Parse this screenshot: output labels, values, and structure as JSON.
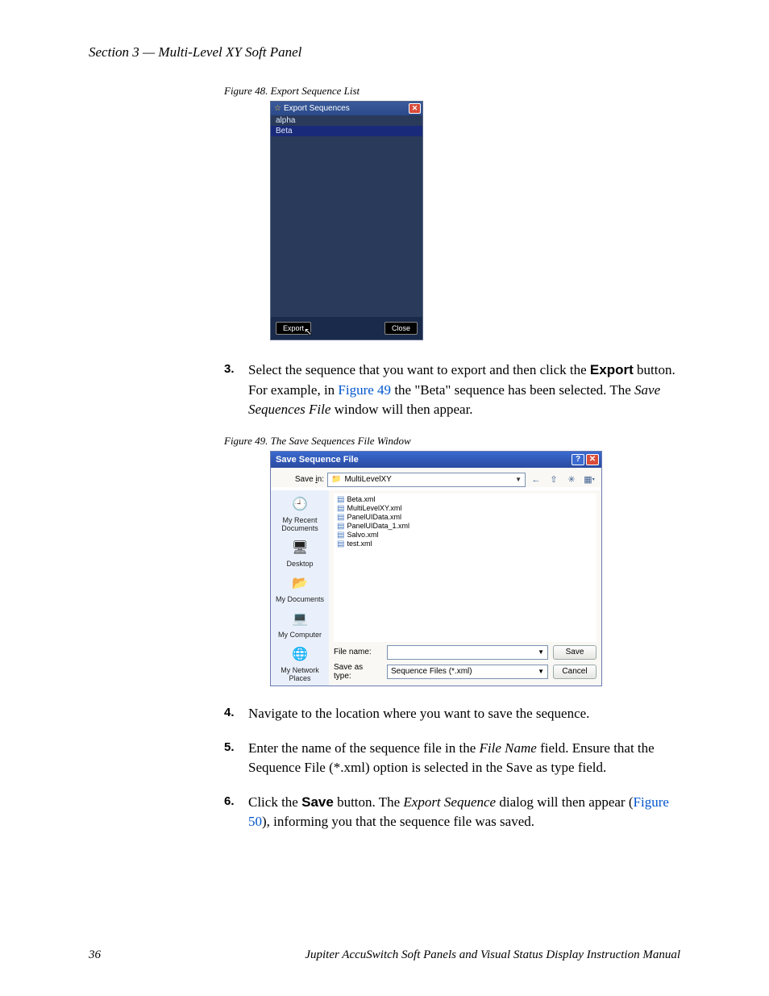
{
  "section_header": "Section 3 — Multi-Level XY Soft Panel",
  "fig48": {
    "caption": "Figure 48.  Export Sequence List",
    "title": "Export Sequences",
    "items": [
      "alpha",
      "Beta"
    ],
    "export_btn": "Export",
    "close_btn": "Close"
  },
  "step3": {
    "num": "3.",
    "t1": "Select the sequence that you want to export and then click the ",
    "export_bold": "Export",
    "t2": " button. For example, in ",
    "link": "Figure 49",
    "t3": " the \"Beta\" sequence has been selected. The ",
    "italic": "Save Sequences File",
    "t4": " window will then appear."
  },
  "fig49": {
    "caption": "Figure 49.  The Save Sequences File Window",
    "title": "Save Sequence File",
    "savein_label": "Save in:",
    "savein_value": "MultiLevelXY",
    "sidebar": [
      "My Recent Documents",
      "Desktop",
      "My Documents",
      "My Computer",
      "My Network Places"
    ],
    "files": [
      "Beta.xml",
      "MultiLevelXY.xml",
      "PanelUIData.xml",
      "PanelUIData_1.xml",
      "Salvo.xml",
      "test.xml"
    ],
    "filename_label": "File name:",
    "saveastype_label": "Save as type:",
    "saveastype_value": "Sequence Files (*.xml)",
    "save_btn": "Save",
    "cancel_btn": "Cancel"
  },
  "step4": {
    "num": "4.",
    "text": "Navigate to the location where you want to save the sequence."
  },
  "step5": {
    "num": "5.",
    "t1": "Enter the name of the sequence file in the ",
    "italic": "File Name",
    "t2": " field. Ensure that the Sequence File (*.xml) option is selected in the Save as type field."
  },
  "step6": {
    "num": "6.",
    "t1": "Click the ",
    "bold": "Save",
    "t2": " button. The ",
    "italic": "Export Sequence",
    "t3": " dialog will then appear (",
    "link": "Figure 50",
    "t4": "), informing you that the sequence file was saved."
  },
  "footer": {
    "page": "36",
    "title": "Jupiter AccuSwitch Soft Panels and Visual Status Display Instruction Manual"
  }
}
